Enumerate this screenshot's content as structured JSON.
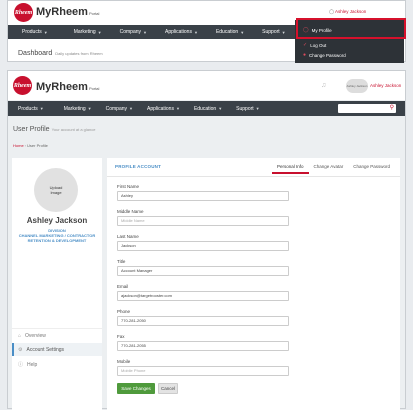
{
  "brand": {
    "badge": "Rheem",
    "name": "MyRheem",
    "sub": "Portal"
  },
  "nav": [
    {
      "label": "Products"
    },
    {
      "label": "Marketing"
    },
    {
      "label": "Company"
    },
    {
      "label": "Applications"
    },
    {
      "label": "Education"
    },
    {
      "label": "Support"
    }
  ],
  "top": {
    "user": "Ashley Jackson",
    "dashboard_title": "Dashboard",
    "dashboard_sub": "Daily updates from Rheem",
    "dropdown": [
      "My Profile",
      "Log Out",
      "Change Password"
    ]
  },
  "profile": {
    "avatar_text": "Ashley Jackson",
    "page_title": "User Profile",
    "page_sub": "Your account at a glance",
    "breadcrumb_home": "Home",
    "breadcrumb_current": "User Profile",
    "avatar_label_1": "Upload",
    "avatar_label_2": "Image",
    "name": "Ashley Jackson",
    "role_1": "DIVISION",
    "role_2": "CHANNEL MARKETING / CONTRACTOR",
    "role_3": "RETENTION & DEVELOPMENT",
    "side_items": [
      "Overview",
      "Account Settings",
      "Help"
    ],
    "section_title": "PROFILE ACCOUNT",
    "tabs": [
      "Personal Info",
      "Change Avatar",
      "Change Password"
    ],
    "fields": [
      {
        "label": "First Name",
        "value": "Ashley",
        "placeholder": ""
      },
      {
        "label": "Middle Name",
        "value": "",
        "placeholder": "Middle Name"
      },
      {
        "label": "Last Name",
        "value": "Jackson",
        "placeholder": ""
      },
      {
        "label": "Title",
        "value": "Account Manager",
        "placeholder": ""
      },
      {
        "label": "Email",
        "value": "ajackson@targetrooster.com",
        "placeholder": ""
      },
      {
        "label": "Phone",
        "value": "770-281-2050",
        "placeholder": ""
      },
      {
        "label": "Fax",
        "value": "770-281-2055",
        "placeholder": ""
      },
      {
        "label": "Mobile",
        "value": "",
        "placeholder": "Mobile Phone"
      }
    ],
    "save_label": "Save Changes",
    "cancel_label": "Cancel"
  },
  "colors": {
    "brand_red": "#c8102e",
    "nav_bg": "#3a4148",
    "accent_blue": "#4a8ec6",
    "save_green": "#4f9a3c"
  }
}
